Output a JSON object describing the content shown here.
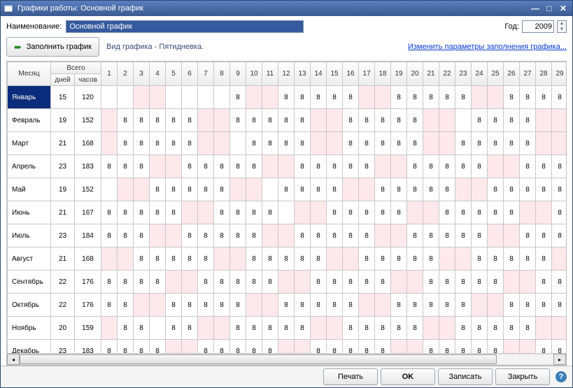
{
  "title": "Графики работы: Основной график",
  "labels": {
    "name": "Наименование:",
    "year": "Год:",
    "fill": "Заполнить график",
    "scheduleType": "Вид графика - Пятидневка.",
    "changeParams": "Изменить параметры заполнения графика...",
    "month": "Месяц",
    "total": "Всего",
    "days": "дней",
    "hours": "часов"
  },
  "form": {
    "nameValue": "Основной график",
    "yearValue": "2009"
  },
  "dayHeaders": [
    "1",
    "2",
    "3",
    "4",
    "5",
    "6",
    "7",
    "8",
    "9",
    "10",
    "11",
    "12",
    "13",
    "14",
    "15",
    "16",
    "17",
    "18",
    "19",
    "20",
    "21",
    "22",
    "23",
    "24",
    "25",
    "26",
    "27",
    "28",
    "29"
  ],
  "rows": [
    {
      "month": "Январь",
      "days": 15,
      "hours": 120,
      "firstWeekday": 4,
      "cells": [
        "",
        "",
        "",
        "",
        "",
        "",
        "",
        "",
        "8",
        "",
        "",
        "8",
        "8",
        "8",
        "8",
        "8",
        "",
        "",
        "8",
        "8",
        "8",
        "8",
        "8",
        "",
        "",
        "8",
        "8",
        "8",
        "8"
      ],
      "selected": true
    },
    {
      "month": "Февраль",
      "days": 19,
      "hours": 152,
      "firstWeekday": 7,
      "cells": [
        "",
        "8",
        "8",
        "8",
        "8",
        "8",
        "",
        "",
        "8",
        "8",
        "8",
        "8",
        "8",
        "",
        "",
        "8",
        "8",
        "8",
        "8",
        "8",
        "",
        "",
        "",
        "8",
        "8",
        "8",
        "8",
        "",
        "",
        ""
      ]
    },
    {
      "month": "Март",
      "days": 21,
      "hours": 168,
      "firstWeekday": 7,
      "cells": [
        "",
        "8",
        "8",
        "8",
        "8",
        "8",
        "",
        "",
        "",
        "8",
        "8",
        "8",
        "8",
        "",
        "",
        "8",
        "8",
        "8",
        "8",
        "8",
        "",
        "",
        "8",
        "8",
        "8",
        "8",
        "8",
        "",
        ""
      ]
    },
    {
      "month": "Апрель",
      "days": 23,
      "hours": 183,
      "firstWeekday": 3,
      "cells": [
        "8",
        "8",
        "8",
        "",
        "",
        "8",
        "8",
        "8",
        "8",
        "8",
        "",
        "",
        "8",
        "8",
        "8",
        "8",
        "8",
        "",
        "",
        "8",
        "8",
        "8",
        "8",
        "8",
        "",
        "",
        "8",
        "8",
        "8"
      ]
    },
    {
      "month": "Май",
      "days": 19,
      "hours": 152,
      "firstWeekday": 5,
      "cells": [
        "",
        "",
        "",
        "8",
        "8",
        "8",
        "8",
        "8",
        "",
        "",
        "",
        "8",
        "8",
        "8",
        "8",
        "",
        "",
        "8",
        "8",
        "8",
        "8",
        "8",
        "",
        "",
        "8",
        "8",
        "8",
        "8",
        "8"
      ]
    },
    {
      "month": "Июнь",
      "days": 21,
      "hours": 167,
      "firstWeekday": 1,
      "cells": [
        "8",
        "8",
        "8",
        "8",
        "8",
        "",
        "",
        "8",
        "8",
        "8",
        "8",
        "",
        "",
        "",
        "8",
        "8",
        "8",
        "8",
        "8",
        "",
        "",
        "8",
        "8",
        "8",
        "8",
        "8",
        "",
        "",
        "8"
      ]
    },
    {
      "month": "Июль",
      "days": 23,
      "hours": 184,
      "firstWeekday": 3,
      "cells": [
        "8",
        "8",
        "8",
        "",
        "",
        "8",
        "8",
        "8",
        "8",
        "8",
        "",
        "",
        "8",
        "8",
        "8",
        "8",
        "8",
        "",
        "",
        "8",
        "8",
        "8",
        "8",
        "8",
        "",
        "",
        "8",
        "8",
        "8"
      ]
    },
    {
      "month": "Август",
      "days": 21,
      "hours": 168,
      "firstWeekday": 6,
      "cells": [
        "",
        "",
        "8",
        "8",
        "8",
        "8",
        "8",
        "",
        "",
        "8",
        "8",
        "8",
        "8",
        "8",
        "",
        "",
        "8",
        "8",
        "8",
        "8",
        "8",
        "",
        "",
        "8",
        "8",
        "8",
        "8",
        "8",
        ""
      ]
    },
    {
      "month": "Сентябрь",
      "days": 22,
      "hours": 176,
      "firstWeekday": 2,
      "cells": [
        "8",
        "8",
        "8",
        "8",
        "",
        "",
        "8",
        "8",
        "8",
        "8",
        "8",
        "",
        "",
        "8",
        "8",
        "8",
        "8",
        "8",
        "",
        "",
        "8",
        "8",
        "8",
        "8",
        "8",
        "",
        "",
        "8",
        "8"
      ]
    },
    {
      "month": "Октябрь",
      "days": 22,
      "hours": 176,
      "firstWeekday": 4,
      "cells": [
        "8",
        "8",
        "",
        "",
        "8",
        "8",
        "8",
        "8",
        "8",
        "",
        "",
        "8",
        "8",
        "8",
        "8",
        "8",
        "",
        "",
        "8",
        "8",
        "8",
        "8",
        "8",
        "",
        "",
        "8",
        "8",
        "8",
        "8"
      ]
    },
    {
      "month": "Ноябрь",
      "days": 20,
      "hours": 159,
      "firstWeekday": 7,
      "cells": [
        "",
        "8",
        "8",
        "",
        "8",
        "8",
        "",
        "",
        "8",
        "8",
        "8",
        "8",
        "8",
        "",
        "",
        "8",
        "8",
        "8",
        "8",
        "8",
        "",
        "",
        "8",
        "8",
        "8",
        "8",
        "8",
        "",
        ""
      ]
    },
    {
      "month": "Декабрь",
      "days": 23,
      "hours": 183,
      "firstWeekday": 2,
      "cells": [
        "8",
        "8",
        "8",
        "8",
        "",
        "",
        "8",
        "8",
        "8",
        "8",
        "8",
        "",
        "",
        "8",
        "8",
        "8",
        "8",
        "8",
        "",
        "",
        "8",
        "8",
        "8",
        "8",
        "8",
        "",
        "",
        "8",
        "8"
      ]
    }
  ],
  "footer": {
    "print": "Печать",
    "ok": "OK",
    "save": "Записать",
    "close": "Закрыть"
  }
}
